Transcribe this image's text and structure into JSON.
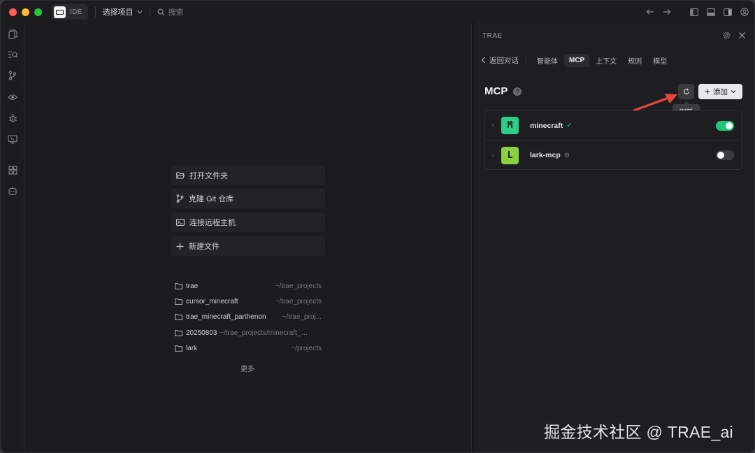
{
  "titlebar": {
    "ide_label": "IDE",
    "project_select": "选择项目",
    "search_placeholder": "搜索"
  },
  "editor": {
    "actions": [
      {
        "label": "打开文件夹",
        "icon": "folder-open-icon"
      },
      {
        "label": "克隆 Git 仓库",
        "icon": "git-branch-icon"
      },
      {
        "label": "连接远程主机",
        "icon": "terminal-icon"
      },
      {
        "label": "新建文件",
        "icon": "plus-icon"
      }
    ],
    "recent": [
      {
        "name": "trae",
        "path": "~/trae_projects"
      },
      {
        "name": "cursor_minecraft",
        "path": "~/trae_projects"
      },
      {
        "name": "trae_minecraft_parthenon",
        "path": "~/trae_proj..."
      },
      {
        "name": "20250803",
        "path": "~/trae_projects/minecraft_m..."
      },
      {
        "name": "lark",
        "path": "~/projects"
      }
    ],
    "more_label": "更多"
  },
  "panel": {
    "title": "TRAE",
    "back_label": "返回对话",
    "tabs": [
      {
        "label": "智能体",
        "active": false
      },
      {
        "label": "MCP",
        "active": true
      },
      {
        "label": "上下文",
        "active": false
      },
      {
        "label": "规则",
        "active": false
      },
      {
        "label": "模型",
        "active": false
      }
    ],
    "mcp_title": "MCP",
    "help_mark": "?",
    "add_label": "添加",
    "refresh_tooltip": "刷新",
    "servers": [
      {
        "name": "minecraft",
        "letter": "M",
        "color": "#2ecc8a",
        "status": "✓",
        "status_color": "#27c27a",
        "enabled": true
      },
      {
        "name": "lark-mcp",
        "letter": "L",
        "color": "#8ad141",
        "status": "⊘",
        "status_color": "#8a8a90",
        "enabled": false
      }
    ]
  },
  "watermark": "掘金技术社区 @ TRAE_ai",
  "colors": {
    "accent_toggle": "#1fc67a",
    "annotation_arrow": "#e8473a"
  }
}
